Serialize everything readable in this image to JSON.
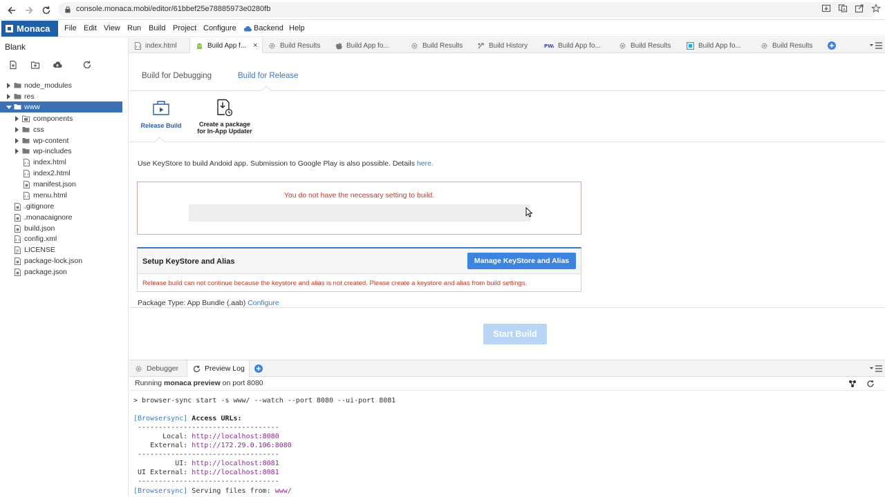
{
  "browser": {
    "url": "console.monaca.mobi/editor/61bbef25e78885973e0280fb"
  },
  "menubar": {
    "brand": "Monaca",
    "items": [
      "File",
      "Edit",
      "View",
      "Run",
      "Build",
      "Project",
      "Configure",
      "Backend",
      "Help"
    ]
  },
  "sidebar": {
    "project_name": "Blank",
    "tree": [
      {
        "label": "node_modules"
      },
      {
        "label": "res"
      },
      {
        "label": "www"
      },
      {
        "label": "components"
      },
      {
        "label": "css"
      },
      {
        "label": "wp-content"
      },
      {
        "label": "wp-includes"
      },
      {
        "label": "index.html"
      },
      {
        "label": "index2.html"
      },
      {
        "label": "manifest.json"
      },
      {
        "label": "menu.html"
      },
      {
        "label": ".gitignore"
      },
      {
        "label": ".monacaignore"
      },
      {
        "label": "build.json"
      },
      {
        "label": "config.xml"
      },
      {
        "label": "LICENSE"
      },
      {
        "label": "package-lock.json"
      },
      {
        "label": "package.json"
      }
    ]
  },
  "tabs": [
    {
      "label": "index.html"
    },
    {
      "label": "Build App f..."
    },
    {
      "label": "Build Results"
    },
    {
      "label": "Build App fo..."
    },
    {
      "label": "Build Results"
    },
    {
      "label": "Build History"
    },
    {
      "label": "Build App fo..."
    },
    {
      "label": "Build Results"
    },
    {
      "label": "Build App fo..."
    },
    {
      "label": "Build Results"
    }
  ],
  "build": {
    "subtabs": [
      "Build for Debugging",
      "Build for Release"
    ],
    "release_build_label": "Release Build",
    "package_option_line1": "Create a package",
    "package_option_line2": "for In-App Updater",
    "description": "Use KeyStore to build Andoid app. Submission to Google Play is also possible. Details ",
    "description_link": "here.",
    "error_message": "You do not have the necessary setting to build.",
    "setup_title": "Setup KeyStore and Alias",
    "manage_button": "Manage KeyStore and Alias",
    "setup_error": "Release build can not continue because the keystore and alias is not created. Please create a keystore and alias from build settings.",
    "package_type": "Package Type: App Bundle (.aab) ",
    "configure_link": "Configure",
    "start_button": "Start Build"
  },
  "bottom": {
    "tabs": [
      "Debugger",
      "Preview Log"
    ],
    "status_prefix": "Running ",
    "status_bold": "monaca preview",
    "status_suffix": " on port ",
    "status_port": "8080",
    "console": {
      "cmd": "> browser-sync start -s www/ --watch --port 8080 --ui-port 8081",
      "tag": "[Browsersync]",
      "access": " Access URLs:",
      "sep": " ----------------------------------",
      "local_label": "       Local: ",
      "local_url": "http://localhost:8080",
      "external_label": "    External: ",
      "external_url": "http://172.29.0.106:8080",
      "ui_label": "          UI: ",
      "ui_url": "http://localhost:8081",
      "ui_ext_label": " UI External: ",
      "ui_ext_url": "http://localhost:8081",
      "serving": " Serving files from: ",
      "serving_path": "www/"
    }
  }
}
